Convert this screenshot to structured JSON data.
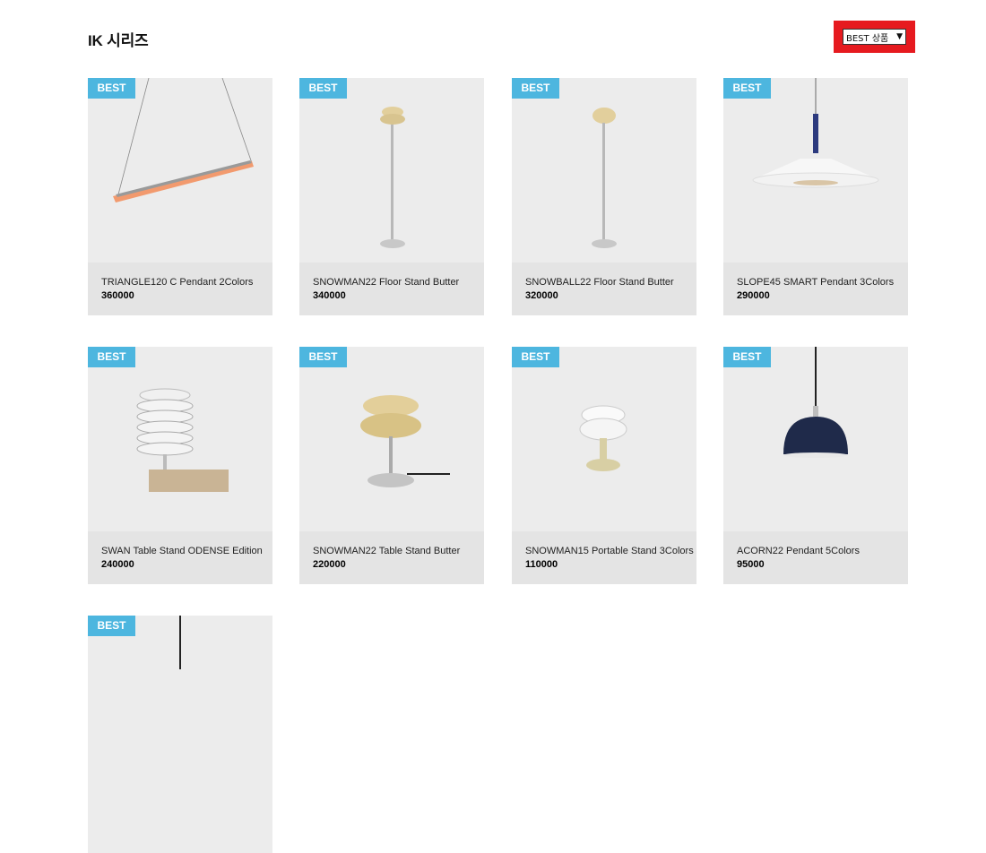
{
  "page": {
    "title": "IK 시리즈"
  },
  "sort": {
    "selected": "BEST 상품"
  },
  "products": [
    {
      "badge": "BEST",
      "name": "TRIANGLE120 C Pendant 2Colors",
      "price": "360000"
    },
    {
      "badge": "BEST",
      "name": "SNOWMAN22 Floor Stand Butter",
      "price": "340000"
    },
    {
      "badge": "BEST",
      "name": "SNOWBALL22 Floor Stand Butter",
      "price": "320000"
    },
    {
      "badge": "BEST",
      "name": "SLOPE45 SMART Pendant 3Colors",
      "price": "290000"
    },
    {
      "badge": "BEST",
      "name": "SWAN Table Stand ODENSE Edition",
      "price": "240000"
    },
    {
      "badge": "BEST",
      "name": "SNOWMAN22 Table Stand Butter",
      "price": "220000"
    },
    {
      "badge": "BEST",
      "name": "SNOWMAN15 Portable Stand 3Colors",
      "price": "110000"
    },
    {
      "badge": "BEST",
      "name": "ACORN22 Pendant 5Colors",
      "price": "95000"
    },
    {
      "badge": "BEST"
    }
  ]
}
